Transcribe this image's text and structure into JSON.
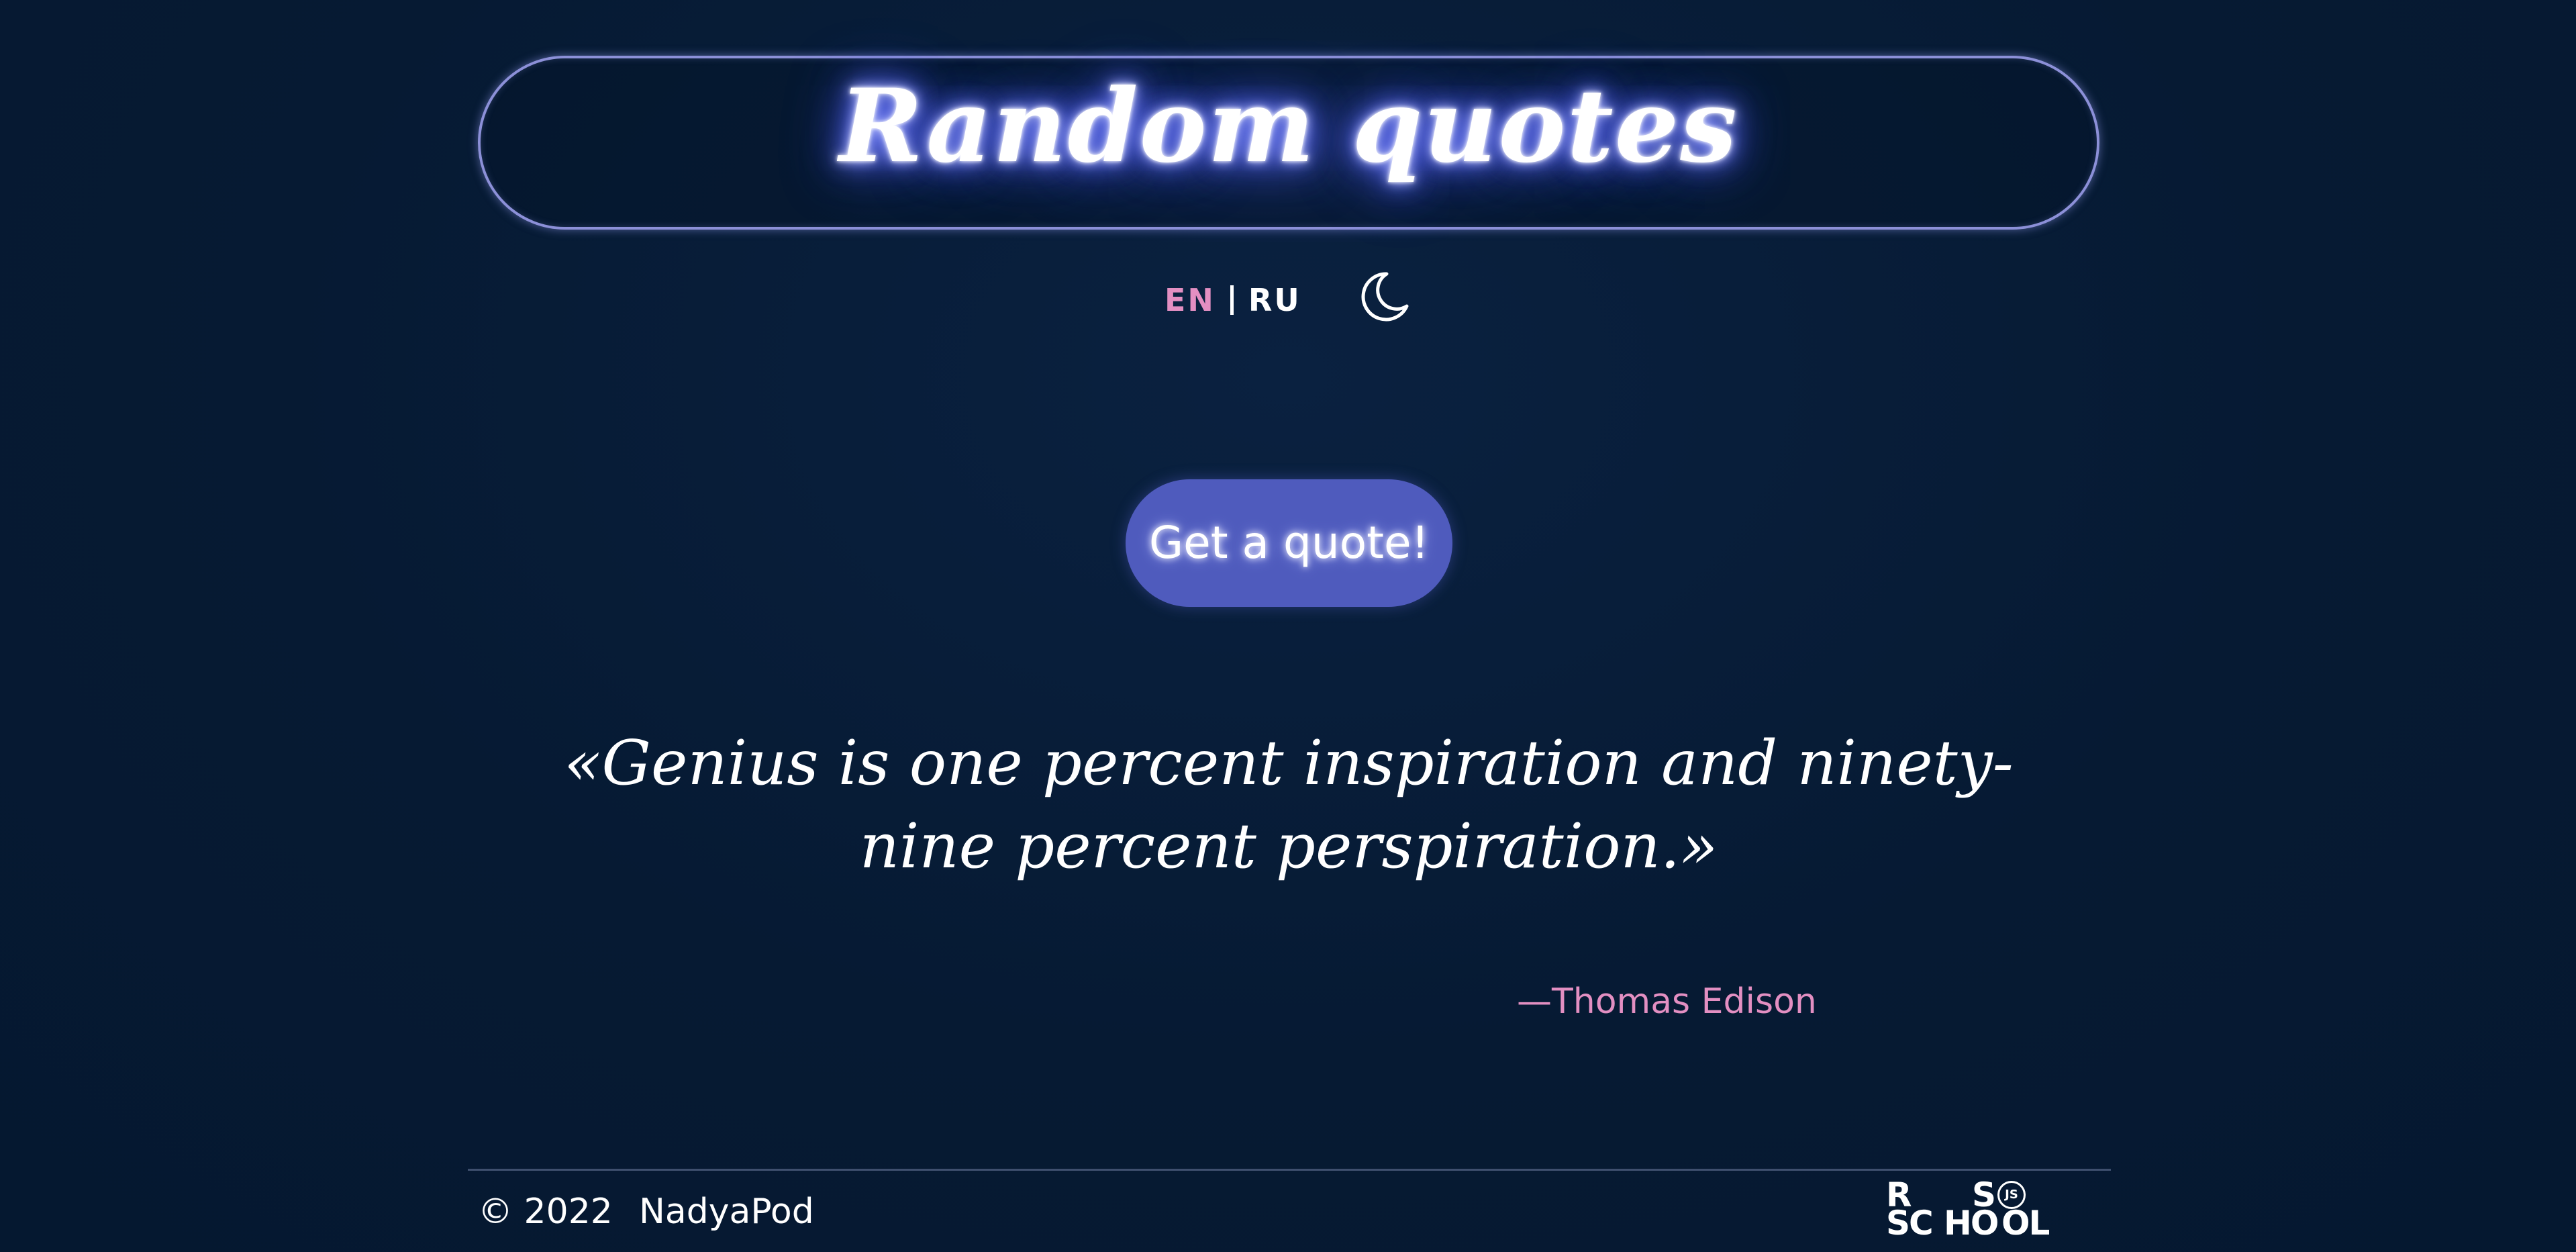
{
  "header": {
    "title": "Random quotes"
  },
  "lang_switch": {
    "en_label": "EN",
    "ru_label": "RU",
    "active": "EN",
    "active_color": "#e38fc2"
  },
  "theme_toggle": {
    "icon": "moon-icon"
  },
  "quote_button": {
    "label": "Get a quote!",
    "color": "#4f5bbd"
  },
  "quote": {
    "text": "«Genius is one percent inspiration and ninety-nine percent perspiration.»",
    "author": "—Thomas Edison"
  },
  "footer": {
    "copyright": "© 2022",
    "author_link": "NadyaPod",
    "logo": {
      "line1_a": "R",
      "line1_b": "S",
      "line2_a": "SC",
      "line2_b": "HO",
      "line2_c": "OL",
      "badge": "JS"
    }
  },
  "colors": {
    "background": "#061a33",
    "accent_pink": "#e38fc2",
    "header_border": "#8c90d8",
    "glow": "#4b5cf0"
  }
}
